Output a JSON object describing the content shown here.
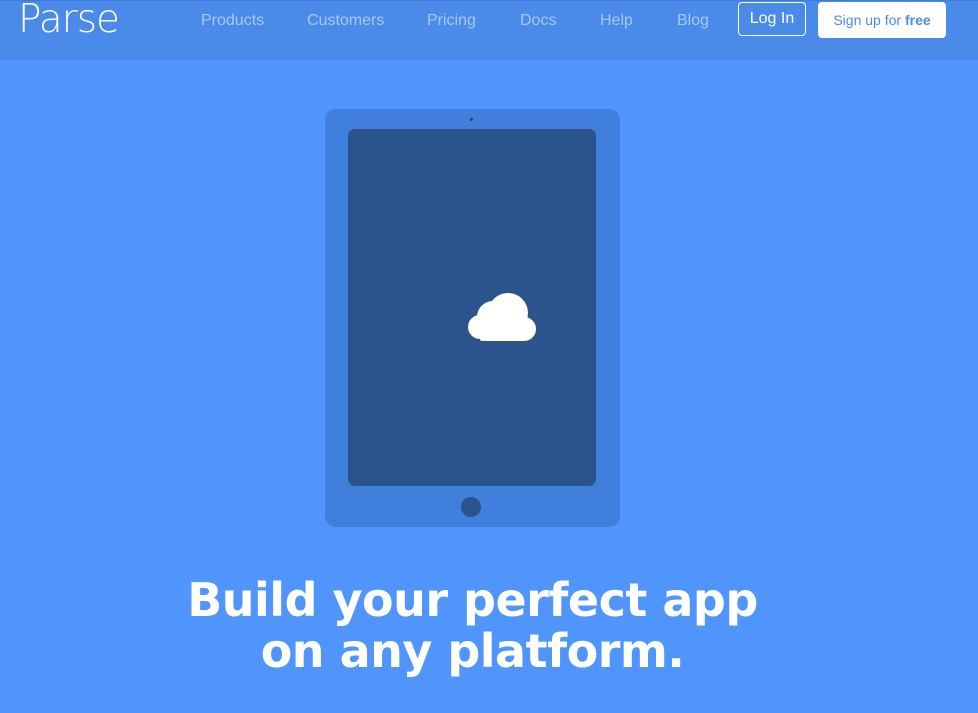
{
  "header": {
    "logo": "Parse",
    "nav": [
      "Products",
      "Customers",
      "Pricing",
      "Docs",
      "Help",
      "Blog"
    ],
    "login_label": "Log In",
    "signup_prefix": "Sign up for ",
    "signup_emphasis": "free"
  },
  "hero": {
    "device_icon": "cloud-icon",
    "headline_line1": "Build your perfect app",
    "headline_line2": "on any platform."
  },
  "colors": {
    "background": "#4f95fc",
    "header": "#4a8ae9",
    "tablet_body": "#407fdc",
    "tablet_screen": "#2b548c",
    "text": "#ffffff",
    "nav_text": "#a9c8f4"
  }
}
